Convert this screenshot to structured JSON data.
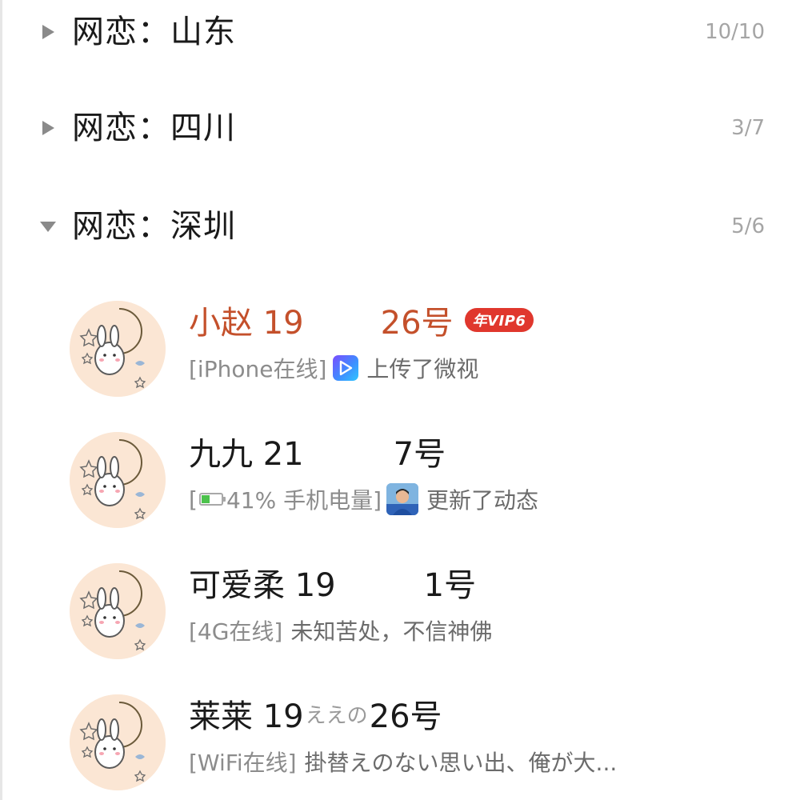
{
  "groups": [
    {
      "title": "网恋：山东",
      "count": "10/10",
      "expanded": false
    },
    {
      "title": "网恋：四川",
      "count": "3/7",
      "expanded": false
    },
    {
      "title": "网恋：深圳",
      "count": "5/6",
      "expanded": true
    }
  ],
  "contacts": [
    {
      "name_prefix": "小赵 19",
      "name_suffix": "26号",
      "vip_badge": "年VIP6",
      "status_tag": "[iPhone在线]",
      "activity": "上传了微视",
      "activity_icon": "weishi-app-icon"
    },
    {
      "name_prefix": "九九 21",
      "name_suffix": "7号",
      "status_tag_open": "[",
      "battery_text": "41% 手机电量]",
      "battery_level": 0.41,
      "activity": "更新了动态",
      "activity_icon": "photo-thumbnail"
    },
    {
      "name_prefix": "可爱柔 19",
      "name_suffix": "1号",
      "status_tag": "[4G在线]",
      "activity": "未知苦处，不信神佛"
    },
    {
      "name_prefix": "莱莱 19",
      "name_middle": "ええの",
      "name_suffix": "26号",
      "status_tag": "[WiFi在线]",
      "activity": "掛替えのない思い出、俺が大..."
    }
  ],
  "colors": {
    "vip_name": "#c4502b",
    "vip_badge_bg": "#e0372d",
    "count_text": "#a5a5a5",
    "status_text": "#8c8c8c",
    "avatar_bg": "#fbe6d4"
  }
}
